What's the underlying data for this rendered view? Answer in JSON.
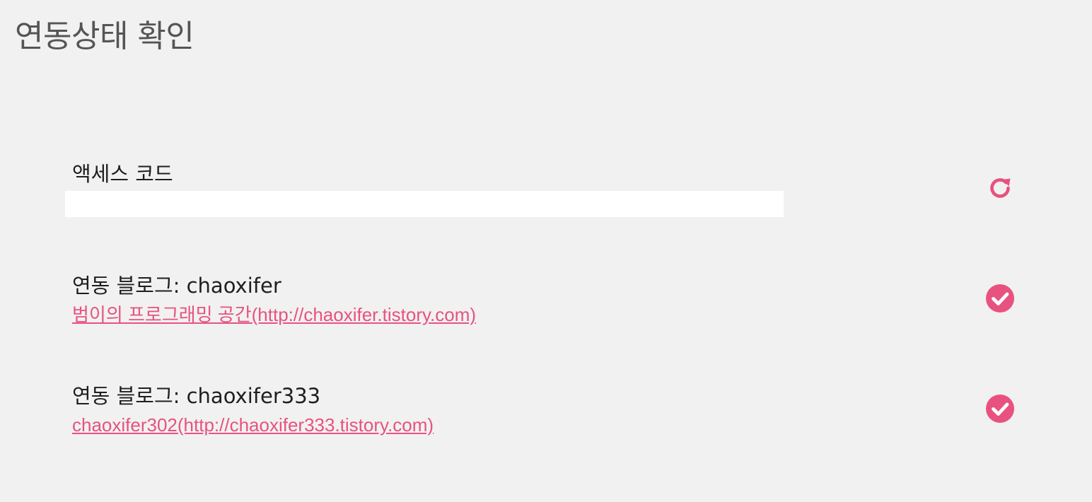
{
  "page": {
    "title": "연동상태 확인"
  },
  "access_code": {
    "label": "액세스 코드",
    "value": "",
    "refresh_icon": "refresh-icon"
  },
  "colors": {
    "accent": "#e8527f",
    "background": "#f1f1f1",
    "title": "#555555",
    "text": "#1f1f1f",
    "input_bg": "#ffffff"
  },
  "blogs": [
    {
      "label": "연동 블로그: chaoxifer",
      "link_text": "범이의 프로그래밍 공간(http://chaoxifer.tistory.com)",
      "status_icon": "check-circle-icon"
    },
    {
      "label": "연동 블로그: chaoxifer333",
      "link_text": "chaoxifer302(http://chaoxifer333.tistory.com)",
      "status_icon": "check-circle-icon"
    }
  ]
}
